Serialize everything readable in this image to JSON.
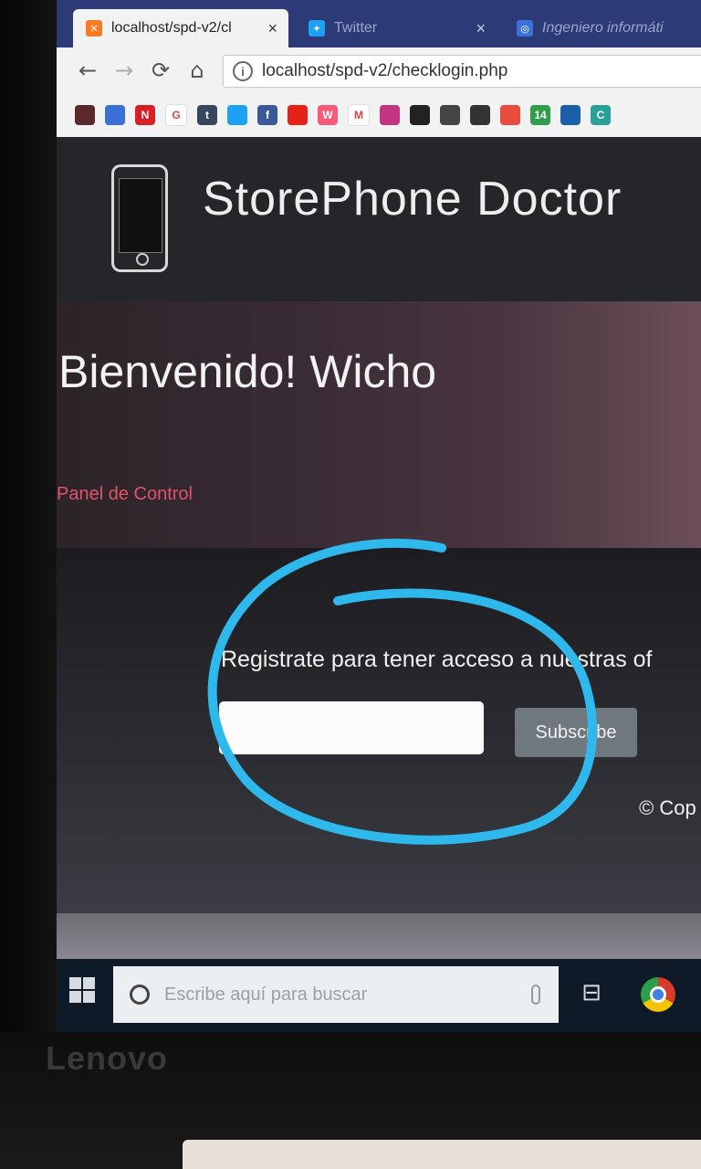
{
  "device": {
    "brand": "Lenovo"
  },
  "browser": {
    "tabs": [
      {
        "title": "localhost/spd-v2/cl",
        "active": true,
        "favicon": "xampp-icon"
      },
      {
        "title": "Twitter",
        "active": false,
        "favicon": "twitter-icon"
      },
      {
        "title": "Ingeniero informáti",
        "active": false,
        "favicon": "link-icon"
      }
    ],
    "url": "localhost/spd-v2/checklogin.php",
    "bookmarks": [
      {
        "icon": "image-icon",
        "label": "",
        "color": "#5a2a2a"
      },
      {
        "icon": "grid-icon",
        "label": "",
        "color": "#3a6fd8"
      },
      {
        "icon": "netflix-icon",
        "label": "N",
        "color": "#d81f26"
      },
      {
        "icon": "google-icon",
        "label": "G",
        "color": "#ffffff"
      },
      {
        "icon": "tumblr-icon",
        "label": "t",
        "color": "#36465d"
      },
      {
        "icon": "twitter-icon",
        "label": "",
        "color": "#1da1f2"
      },
      {
        "icon": "facebook-icon",
        "label": "f",
        "color": "#3b5998"
      },
      {
        "icon": "youtube-icon",
        "label": "",
        "color": "#e62117"
      },
      {
        "icon": "wattpad-icon",
        "label": "W",
        "color": "#f55c7a"
      },
      {
        "icon": "gmail-icon",
        "label": "M",
        "color": "#ffffff"
      },
      {
        "icon": "instagram-icon",
        "label": "",
        "color": "#c13584"
      },
      {
        "icon": "github-icon",
        "label": "",
        "color": "#222222"
      },
      {
        "icon": "server-icon",
        "label": "",
        "color": "#444444"
      },
      {
        "icon": "portrait-icon",
        "label": "",
        "color": "#333333"
      },
      {
        "icon": "windows-icon",
        "label": "",
        "color": "#e74c3c"
      },
      {
        "icon": "badge-icon",
        "label": "14",
        "color": "#2e9e4d"
      },
      {
        "icon": "star-icon",
        "label": "",
        "color": "#1a5fa8"
      },
      {
        "icon": "c-icon",
        "label": "C",
        "color": "#2aa198"
      }
    ]
  },
  "page": {
    "brand": "StorePhone Doctor",
    "welcome": "Bienvenido! Wicho",
    "panel_link": "Panel de Control",
    "register_text": "Registrate para tener acceso a nuestras of",
    "email_placeholder": "",
    "subscribe_label": "Subscribe",
    "copyright": "© Cop"
  },
  "taskbar": {
    "search_placeholder": "Escribe aquí para buscar"
  },
  "colors": {
    "tabstrip": "#2c3b78",
    "panel_link": "#e2526a",
    "annotation": "#2fb8ec"
  }
}
